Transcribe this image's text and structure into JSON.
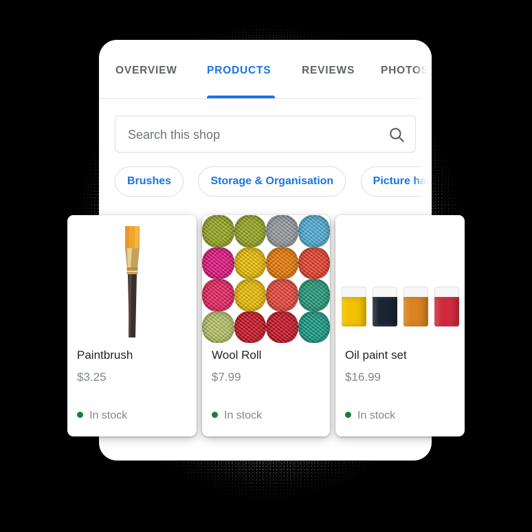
{
  "tabs": [
    {
      "label": "OVERVIEW",
      "active": false
    },
    {
      "label": "PRODUCTS",
      "active": true
    },
    {
      "label": "REVIEWS",
      "active": false
    },
    {
      "label": "PHOTOS",
      "active": false
    }
  ],
  "search": {
    "placeholder": "Search this shop",
    "value": "",
    "icon": "search-icon"
  },
  "chips": [
    {
      "label": "Brushes"
    },
    {
      "label": "Storage & Organisation"
    },
    {
      "label": "Picture hangers"
    }
  ],
  "products": [
    {
      "title": "Paintbrush",
      "price": "$3.25",
      "stock": "In stock",
      "image": "paintbrush-photo"
    },
    {
      "title": "Wool Roll",
      "price": "$7.99",
      "stock": "In stock",
      "image": "wool-rolls-photo"
    },
    {
      "title": "Oil paint set",
      "price": "$16.99",
      "stock": "In stock",
      "image": "oil-paint-jars-photo"
    }
  ],
  "colors": {
    "accent": "#1a73e8",
    "tab_inactive": "#5f6368",
    "muted_text": "#80868b",
    "in_stock_dot": "#188038",
    "title_text": "#202124",
    "page_background": "#000000",
    "panel_background": "#ffffff",
    "border": "#dadce0"
  },
  "artwork": {
    "yarn_colors": [
      "#9aab1f",
      "#9aab1f",
      "#9a9fa3",
      "#4fb3dd",
      "#e8117f",
      "#f5c400",
      "#f07c00",
      "#ef3e2a",
      "#ef2060",
      "#f5c400",
      "#ef4436",
      "#1f9e7a",
      "#bcc96a",
      "#cf1020",
      "#cf1020",
      "#169e84"
    ],
    "paint_jar_colors": [
      "#f2c200",
      "#1b2433",
      "#d98420",
      "#d12a3e"
    ],
    "paint_lid_color": "#f7f7f7",
    "brush_bristle_color": "#f0a52b",
    "brush_ferrule_color": "#c79a4a",
    "brush_handle_color": "#3b2f2c"
  }
}
